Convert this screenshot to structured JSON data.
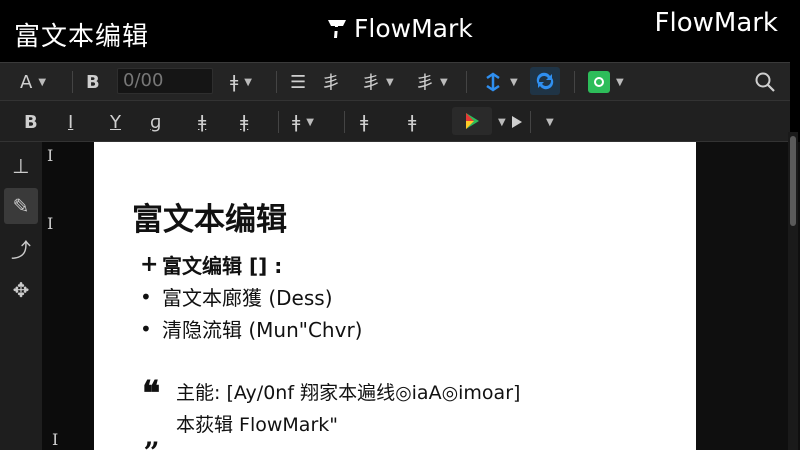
{
  "window": {
    "title": "富文本编辑",
    "brand": "FlowMark",
    "brand_right": "FlowMark"
  },
  "toolbar": {
    "font_label": "A",
    "bold_label": "B",
    "font_size_value": "0/00",
    "text_size_glyph": "ǂ",
    "align_glyph_1": "☰",
    "align_glyph_2": "丯",
    "align_glyph_3": "丯",
    "accent_blue": "#2f8ff0",
    "accent_green": "#2dbd5a"
  },
  "toolbar2": {
    "bold": "B",
    "italic": "I",
    "underline": "Y",
    "strike": "ɡ",
    "align_left": "ǂ",
    "align_center": "ǂ",
    "align_right": "ǂ",
    "indent": "ǂ",
    "outdent": "ǂ"
  },
  "document": {
    "heading": "富文本编辑",
    "list": [
      {
        "marker": "+",
        "text": "富文编辑 [] :"
      },
      {
        "marker": "•",
        "text": "富文本廊獲 (Dess)"
      },
      {
        "marker": "•",
        "text": "清隐流辑 (Mun\"Chvr)"
      }
    ],
    "quote_line_1": "主能: [Ay/0nf 翔家本遍线◎iaA◎imoar]",
    "quote_line_2": "本荻辑 FlowMark\"",
    "quote_open": "❝",
    "quote_close": "„"
  }
}
